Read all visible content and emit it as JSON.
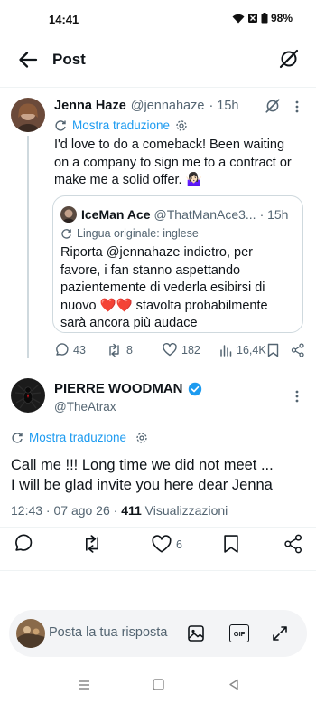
{
  "status": {
    "time": "14:41",
    "battery": "98%"
  },
  "header": {
    "title": "Post"
  },
  "reply": {
    "name": "Jenna Haze",
    "handle": "@jennahaze",
    "time": "· 15h",
    "translate": "Mostra traduzione",
    "text_lines": [
      "I'd love to do a comeback! Been waiting",
      "on a company to sign me to a contract or",
      "make me a solid offer. 🤷🏻‍♀️"
    ],
    "quote": {
      "name": "IceMan Ace",
      "handle": "@ThatManAce3...",
      "time": "· 15h",
      "original_lang": "Lingua originale: inglese",
      "text_lines": [
        "Riporta @jennahaze indietro, per",
        "favore, i fan stanno aspettando",
        "pazientemente di vederla esibirsi di",
        "nuovo ❤️❤️ stavolta probabilmente",
        "sarà ancora più audace"
      ]
    },
    "actions": {
      "replies": "43",
      "reposts": "8",
      "likes": "182",
      "views": "16,4K"
    }
  },
  "main": {
    "name": "PIERRE WOODMAN",
    "handle": "@TheAtrax",
    "translate": "Mostra traduzione",
    "text_lines": [
      "Call me !!! Long time we did not meet ...",
      "I will be glad invite you here dear Jenna"
    ],
    "timestamp": "12:43 · 07 ago 26 · ",
    "views_count": "411",
    "views_label": " Visualizzazioni",
    "likes": "6"
  },
  "composer": {
    "placeholder": "Posta la tua risposta",
    "gif": "GIF"
  },
  "colors": {
    "accent": "#1d9bf0",
    "muted": "#536471",
    "verified": "#1d9bf0"
  }
}
